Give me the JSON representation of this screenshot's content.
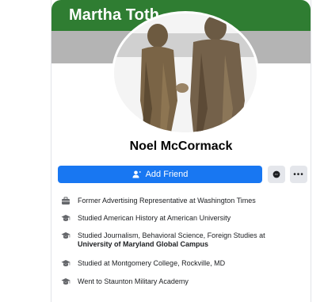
{
  "header": {
    "title": "Martha Toth"
  },
  "profile": {
    "name": "Noel McCormack"
  },
  "actions": {
    "add_friend_label": "Add Friend",
    "more_label": "•••"
  },
  "info": [
    {
      "icon": "briefcase-icon",
      "text": "Former Advertising Representative at Washington Times"
    },
    {
      "icon": "graduation-cap-icon",
      "text": "Studied American History at American University"
    },
    {
      "icon": "graduation-cap-icon",
      "text": "Studied Journalism, Behavioral Science, Foreign Studies at",
      "bold_text": "University of Maryland Global Campus"
    },
    {
      "icon": "graduation-cap-icon",
      "text": "Studied at Montgomery College, Rockville, MD"
    },
    {
      "icon": "graduation-cap-icon",
      "text": "Went to Staunton Military Academy"
    }
  ],
  "colors": {
    "banner": "#2f7d32",
    "button": "#1877f2"
  }
}
